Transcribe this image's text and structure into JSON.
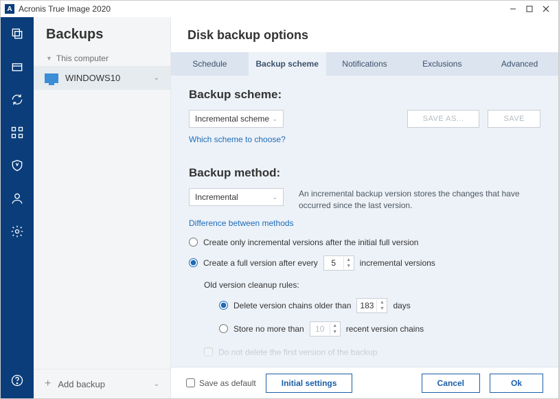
{
  "titlebar": {
    "app_name": "Acronis True Image 2020"
  },
  "sidepanel": {
    "heading": "Backups",
    "group_label": "This computer",
    "item_label": "WINDOWS10",
    "add_backup_label": "Add backup"
  },
  "main": {
    "title": "Disk backup options",
    "tabs": {
      "schedule": "Schedule",
      "scheme": "Backup scheme",
      "notifications": "Notifications",
      "exclusions": "Exclusions",
      "advanced": "Advanced"
    },
    "scheme": {
      "heading": "Backup scheme:",
      "dropdown_value": "Incremental scheme",
      "save_as_label": "SAVE AS...",
      "save_label": "SAVE",
      "help_link": "Which scheme to choose?"
    },
    "method": {
      "heading": "Backup method:",
      "dropdown_value": "Incremental",
      "description": "An incremental backup version stores the changes that have occurred since the last version.",
      "help_link": "Difference between methods",
      "opt1_label": "Create only incremental versions after the initial full version",
      "opt2_prefix": "Create a full version after every",
      "opt2_value": "5",
      "opt2_suffix": "incremental versions",
      "cleanup_heading": "Old version cleanup rules:",
      "clean1_prefix": "Delete version chains older than",
      "clean1_value": "183",
      "clean1_suffix": "days",
      "clean2_prefix": "Store no more than",
      "clean2_value": "10",
      "clean2_suffix": "recent version chains",
      "clean3_label": "Do not delete the first version of the backup"
    }
  },
  "footer": {
    "save_default_label": "Save as default",
    "initial_label": "Initial settings",
    "cancel_label": "Cancel",
    "ok_label": "Ok"
  }
}
